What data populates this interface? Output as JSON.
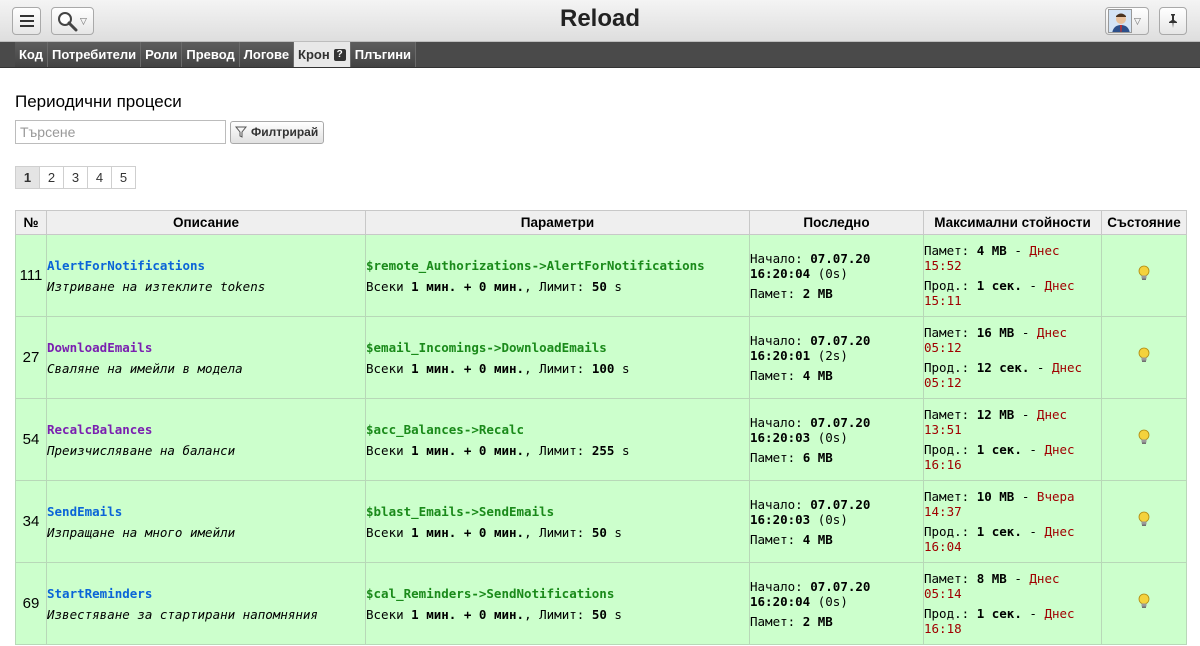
{
  "app": {
    "title": "Reload",
    "menu_icon": "hamburger-icon",
    "search_icon": "magnifier-icon",
    "pin_icon": "pushpin-icon"
  },
  "nav": {
    "tabs": [
      {
        "label": "Код"
      },
      {
        "label": "Потребители"
      },
      {
        "label": "Роли"
      },
      {
        "label": "Превод"
      },
      {
        "label": "Логове"
      },
      {
        "label": "Крон",
        "active": true
      },
      {
        "label": "Плъгини"
      }
    ],
    "help_glyph": "?"
  },
  "page": {
    "heading": "Периодични процеси",
    "search_placeholder": "Търсене",
    "filter_label": "Филтрирай",
    "pages": [
      "1",
      "2",
      "3",
      "4",
      "5"
    ],
    "current_page": "1"
  },
  "table": {
    "headers": [
      "№",
      "Описание",
      "Параметри",
      "Последно",
      "Максимални стойности",
      "Състояние"
    ],
    "rows": [
      {
        "id": "111",
        "name": "AlertForNotifications",
        "name_color": "#0a64d8",
        "description": "Изтриване на изтеклите tokens",
        "handler": "$remote_Authorizations->AlertForNotifications",
        "every_label": "Всеки",
        "every_val": "1 мин.",
        "plus": "+",
        "offset_val": "0 мин.",
        "limit_label": ", Лимит:",
        "limit_val": "50",
        "limit_unit": "s",
        "start_label": "Начало:",
        "start_date": "07.07.20",
        "start_time": "16:20:04",
        "duration": "(0s)",
        "mem_label": "Памет:",
        "mem_val": "2 MB",
        "max_mem_label": "Памет:",
        "max_mem_val": "4 MB",
        "max_mem_sep": "-",
        "max_mem_day": "Днес",
        "max_mem_time": "15:52",
        "max_dur_label": "Прод.:",
        "max_dur_val": "1 сек.",
        "max_dur_sep": "-",
        "max_dur_day": "Днес",
        "max_dur_time": "15:11",
        "state_icon": "lightbulb-icon"
      },
      {
        "id": "27",
        "name": "DownloadEmails",
        "name_color": "#7a1fb0",
        "description": "Сваляне на имейли в модела",
        "handler": "$email_Incomings->DownloadEmails",
        "every_label": "Всеки",
        "every_val": "1 мин.",
        "plus": "+",
        "offset_val": "0 мин.",
        "limit_label": ", Лимит:",
        "limit_val": "100",
        "limit_unit": "s",
        "start_label": "Начало:",
        "start_date": "07.07.20",
        "start_time": "16:20:01",
        "duration": "(2s)",
        "mem_label": "Памет:",
        "mem_val": "4 MB",
        "max_mem_label": "Памет:",
        "max_mem_val": "16 MB",
        "max_mem_sep": "-",
        "max_mem_day": "Днес",
        "max_mem_time": "05:12",
        "max_dur_label": "Прод.:",
        "max_dur_val": "12 сек.",
        "max_dur_sep": "-",
        "max_dur_day": "Днес",
        "max_dur_time": "05:12",
        "state_icon": "lightbulb-icon"
      },
      {
        "id": "54",
        "name": "RecalcBalances",
        "name_color": "#7a1fb0",
        "description": "Преизчисляване на баланси",
        "handler": "$acc_Balances->Recalc",
        "every_label": "Всеки",
        "every_val": "1 мин.",
        "plus": "+",
        "offset_val": "0 мин.",
        "limit_label": ", Лимит:",
        "limit_val": "255",
        "limit_unit": "s",
        "start_label": "Начало:",
        "start_date": "07.07.20",
        "start_time": "16:20:03",
        "duration": "(0s)",
        "mem_label": "Памет:",
        "mem_val": "6 MB",
        "max_mem_label": "Памет:",
        "max_mem_val": "12 MB",
        "max_mem_sep": "-",
        "max_mem_day": "Днес",
        "max_mem_time": "13:51",
        "max_dur_label": "Прод.:",
        "max_dur_val": "1 сек.",
        "max_dur_sep": "-",
        "max_dur_day": "Днес",
        "max_dur_time": "16:16",
        "state_icon": "lightbulb-icon"
      },
      {
        "id": "34",
        "name": "SendEmails",
        "name_color": "#0a64d8",
        "description": "Изпращане на много имейли",
        "handler": "$blast_Emails->SendEmails",
        "every_label": "Всеки",
        "every_val": "1 мин.",
        "plus": "+",
        "offset_val": "0 мин.",
        "limit_label": ", Лимит:",
        "limit_val": "50",
        "limit_unit": "s",
        "start_label": "Начало:",
        "start_date": "07.07.20",
        "start_time": "16:20:03",
        "duration": "(0s)",
        "mem_label": "Памет:",
        "mem_val": "4 MB",
        "max_mem_label": "Памет:",
        "max_mem_val": "10 MB",
        "max_mem_sep": "-",
        "max_mem_day": "Вчера",
        "max_mem_time": "14:37",
        "max_dur_label": "Прод.:",
        "max_dur_val": "1 сек.",
        "max_dur_sep": "-",
        "max_dur_day": "Днес",
        "max_dur_time": "16:04",
        "state_icon": "lightbulb-icon"
      },
      {
        "id": "69",
        "name": "StartReminders",
        "name_color": "#0a64d8",
        "description": "Известяване за стартирани напомняния",
        "handler": "$cal_Reminders->SendNotifications",
        "every_label": "Всеки",
        "every_val": "1 мин.",
        "plus": "+",
        "offset_val": "0 мин.",
        "limit_label": ", Лимит:",
        "limit_val": "50",
        "limit_unit": "s",
        "start_label": "Начало:",
        "start_date": "07.07.20",
        "start_time": "16:20:04",
        "duration": "(0s)",
        "mem_label": "Памет:",
        "mem_val": "2 MB",
        "max_mem_label": "Памет:",
        "max_mem_val": "8 MB",
        "max_mem_sep": "-",
        "max_mem_day": "Днес",
        "max_mem_time": "05:14",
        "max_dur_label": "Прод.:",
        "max_dur_val": "1 сек.",
        "max_dur_sep": "-",
        "max_dur_day": "Днес",
        "max_dur_time": "16:18",
        "state_icon": "lightbulb-icon"
      }
    ]
  },
  "colors": {
    "row_bg": "#ccffcc",
    "handler": "#1a8a1a",
    "date_red": "#a00000",
    "nav_bg": "#4a4a4a"
  }
}
